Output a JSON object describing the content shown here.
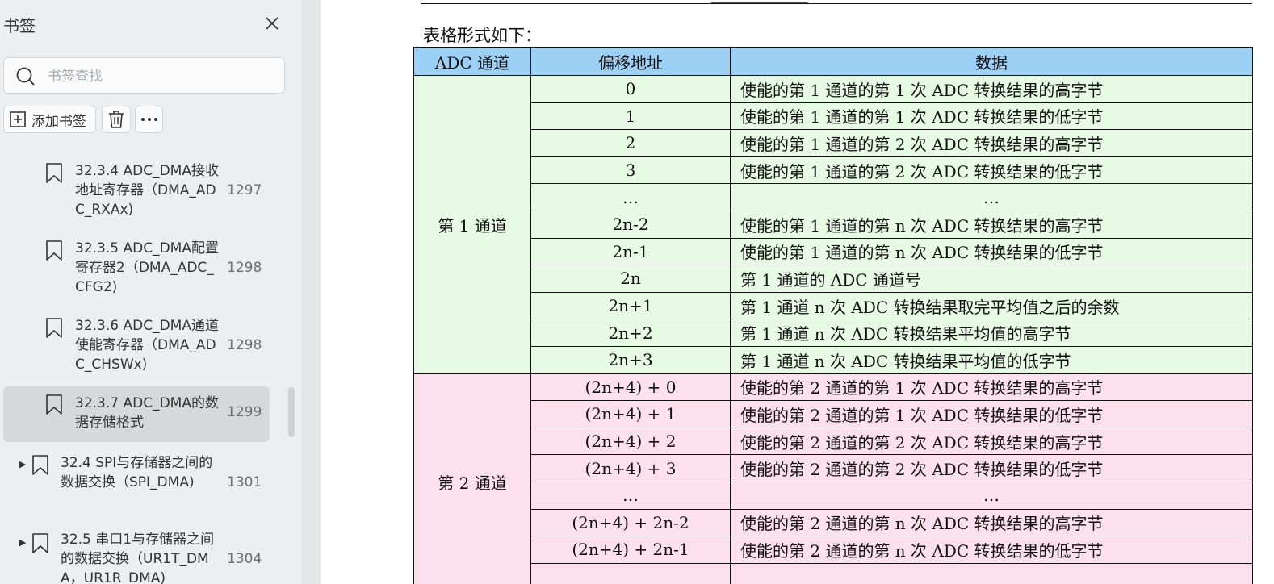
{
  "sidebar": {
    "title": "书签",
    "search_placeholder": "书签查找",
    "add_label": "添加书签",
    "bookmarks": [
      {
        "label": "32.3.4 ADC_DMA接收地址寄存器（DMA_ADC_RXAx)",
        "page": "1297"
      },
      {
        "label": "32.3.5 ADC_DMA配置寄存器2（DMA_ADC_CFG2)",
        "page": "1298"
      },
      {
        "label": "32.3.6 ADC_DMA通道使能寄存器（DMA_ADC_CHSWx)",
        "page": "1298"
      },
      {
        "label": "32.3.7 ADC_DMA的数据存储格式",
        "page": "1299"
      },
      {
        "label": "32.4 SPI与存储器之间的数据交换（SPI_DMA)",
        "page": "1301"
      },
      {
        "label": "32.5 串口1与存储器之间的数据交换（UR1T_DMA，UR1R_DMA)",
        "page": "1304"
      }
    ]
  },
  "doc": {
    "intro": "表格形式如下：",
    "table": {
      "headers": [
        "ADC 通道",
        "偏移地址",
        "数据"
      ],
      "group1": {
        "channel": "第 1 通道",
        "rows": [
          {
            "offset": "0",
            "data": "使能的第 1 通道的第 1 次 ADC 转换结果的高字节"
          },
          {
            "offset": "1",
            "data": "使能的第 1 通道的第 1 次 ADC 转换结果的低字节"
          },
          {
            "offset": "2",
            "data": "使能的第 1 通道的第 2 次 ADC 转换结果的高字节"
          },
          {
            "offset": "3",
            "data": "使能的第 1 通道的第 2 次 ADC 转换结果的低字节"
          },
          {
            "offset": "…",
            "data": "…"
          },
          {
            "offset": "2n-2",
            "data": "使能的第 1 通道的第 n 次 ADC 转换结果的高字节"
          },
          {
            "offset": "2n-1",
            "data": "使能的第 1 通道的第 n 次 ADC 转换结果的低字节"
          },
          {
            "offset": "2n",
            "data": "第 1 通道的 ADC 通道号"
          },
          {
            "offset": "2n+1",
            "data": "第 1 通道 n 次 ADC 转换结果取完平均值之后的余数"
          },
          {
            "offset": "2n+2",
            "data": "第 1 通道 n 次 ADC 转换结果平均值的高字节"
          },
          {
            "offset": "2n+3",
            "data": "第 1 通道 n 次 ADC 转换结果平均值的低字节"
          }
        ]
      },
      "group2": {
        "channel": "第 2 通道",
        "rows": [
          {
            "offset": "(2n+4) + 0",
            "data": "使能的第 2 通道的第 1 次 ADC 转换结果的高字节"
          },
          {
            "offset": "(2n+4) + 1",
            "data": "使能的第 2 通道的第 1 次 ADC 转换结果的低字节"
          },
          {
            "offset": "(2n+4) + 2",
            "data": "使能的第 2 通道的第 2 次 ADC 转换结果的高字节"
          },
          {
            "offset": "(2n+4) + 3",
            "data": "使能的第 2 通道的第 2 次 ADC 转换结果的低字节"
          },
          {
            "offset": "…",
            "data": "…"
          },
          {
            "offset": "(2n+4) + 2n-2",
            "data": "使能的第 2 通道的第 n 次 ADC 转换结果的高字节"
          },
          {
            "offset": "(2n+4) + 2n-1",
            "data": "使能的第 2 通道的第 n 次 ADC 转换结果的低字节"
          },
          {
            "offset": "",
            "data": ""
          }
        ]
      }
    }
  },
  "colors": {
    "header_bg": "#9dd0f5",
    "group1_bg": "#e7fbe4",
    "group2_bg": "#fde0ee",
    "sidebar_bg": "#eceef0"
  },
  "icons": [
    "close-icon",
    "search-icon",
    "add-bookmark-icon",
    "trash-icon",
    "more-icon",
    "bookmark-icon",
    "expand-arrow-icon"
  ]
}
